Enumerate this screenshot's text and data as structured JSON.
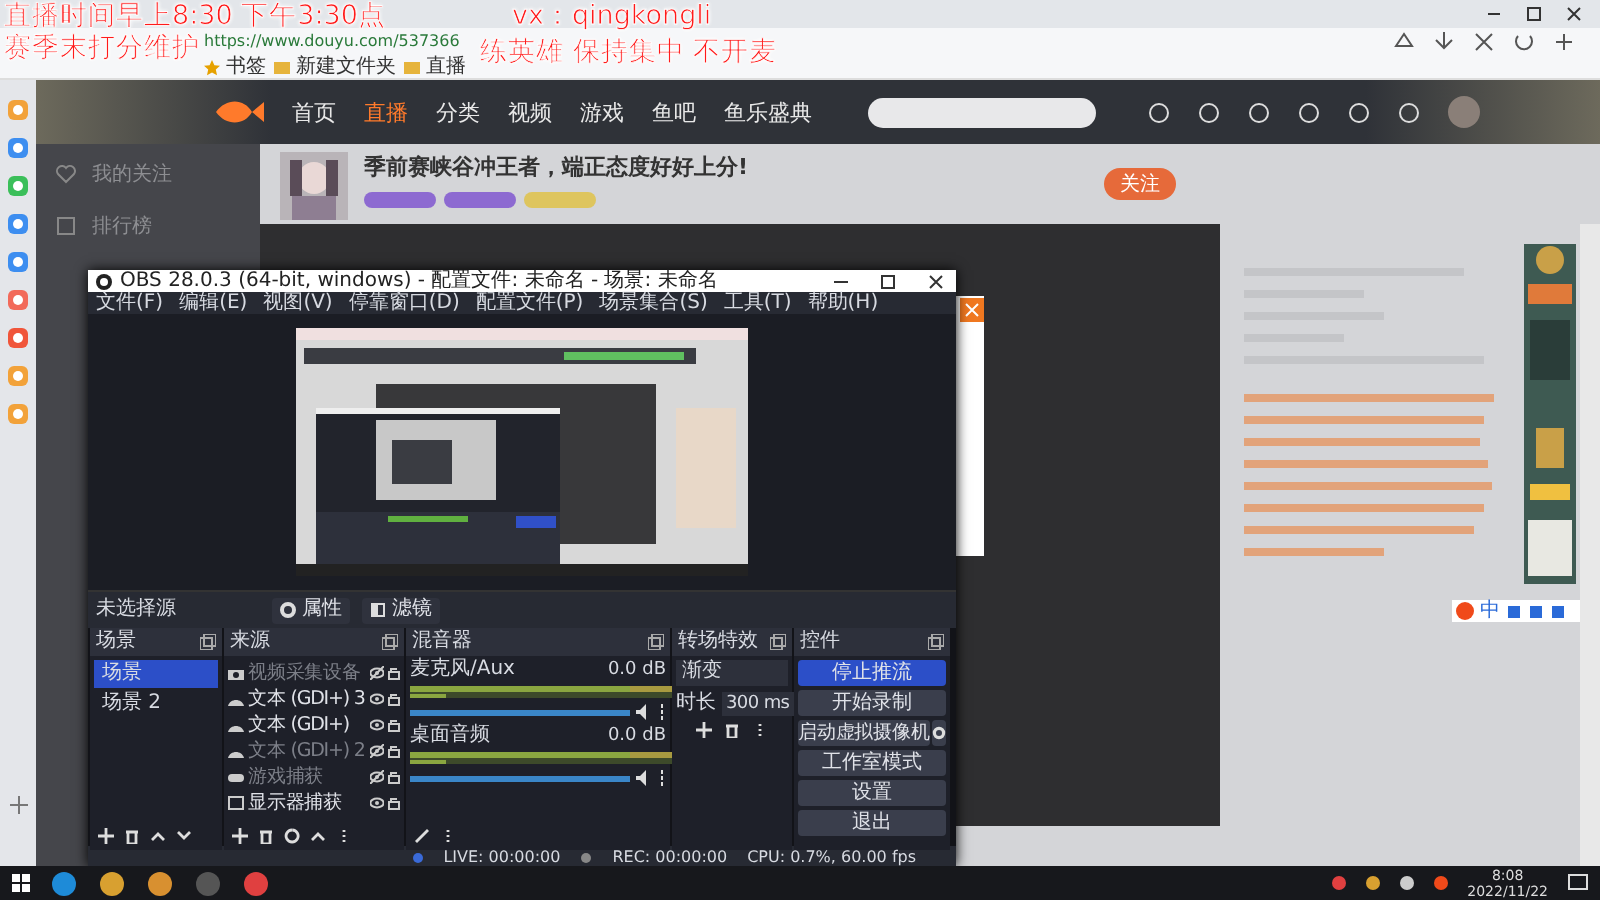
{
  "overlay": {
    "left_lines": [
      "直播时间早上8:30  下午3:30点",
      "赛季末打分维护"
    ],
    "right_lines": [
      "vx：qingkongli",
      "练英雄 保持集中 不开麦"
    ]
  },
  "browser": {
    "address": "https://www.douyu.com/537366",
    "bookmarks": [
      "书签",
      "新建文件夹",
      "直播"
    ],
    "nav": [
      {
        "label": "首页",
        "selected": false
      },
      {
        "label": "直播",
        "selected": true
      },
      {
        "label": "分类",
        "selected": false
      },
      {
        "label": "视频",
        "selected": false
      },
      {
        "label": "游戏",
        "selected": false
      },
      {
        "label": "鱼吧",
        "selected": false
      },
      {
        "label": "鱼乐盛典",
        "selected": false
      }
    ],
    "sidebar": [
      "我的关注",
      "排行榜"
    ],
    "room_title": "季前赛峡谷冲王者，端正态度好好上分!",
    "follow": "关注",
    "ime": "中"
  },
  "obs": {
    "title": "OBS 28.0.3 (64-bit, windows) - 配置文件: 未命名 - 场景: 未命名",
    "menu": [
      "文件(F)",
      "编辑(E)",
      "视图(V)",
      "停靠窗口(D)",
      "配置文件(P)",
      "场景集合(S)",
      "工具(T)",
      "帮助(H)"
    ],
    "no_source": "未选择源",
    "properties": "属性",
    "filters": "滤镜",
    "scenes": {
      "title": "场景",
      "items": [
        {
          "label": "场景",
          "selected": true
        },
        {
          "label": "场景 2",
          "selected": false
        }
      ]
    },
    "sources": {
      "title": "来源",
      "items": [
        {
          "label": "视频采集设备",
          "kind": "camera",
          "visible": false
        },
        {
          "label": "文本 (GDI+) 3",
          "kind": "text",
          "visible": true
        },
        {
          "label": "文本 (GDI+)",
          "kind": "text",
          "visible": true
        },
        {
          "label": "文本 (GDI+) 2",
          "kind": "text",
          "visible": false
        },
        {
          "label": "游戏捕获",
          "kind": "game",
          "visible": false
        },
        {
          "label": "显示器捕获",
          "kind": "monitor",
          "visible": true
        }
      ]
    },
    "mixer": {
      "title": "混音器",
      "channels": [
        {
          "name": "麦克风/Aux",
          "reading": "0.0 dB",
          "level": 1
        },
        {
          "name": "桌面音频",
          "reading": "0.0 dB",
          "level": 1
        }
      ]
    },
    "transitions": {
      "title": "转场特效",
      "value": "渐变",
      "duration_label": "时长",
      "duration": "300 ms"
    },
    "controls": {
      "title": "控件",
      "buttons": [
        {
          "label": "停止推流",
          "kind": "primary"
        },
        {
          "label": "开始录制",
          "kind": "plain"
        },
        {
          "label": "启动虚拟摄像机",
          "kind": "settings"
        },
        {
          "label": "工作室模式",
          "kind": "plain"
        },
        {
          "label": "设置",
          "kind": "plain"
        },
        {
          "label": "退出",
          "kind": "plain"
        }
      ]
    },
    "status": [
      "LIVE: 00:00:00",
      "REC: 00:00:00",
      "CPU: 0.7%, 60.00 fps"
    ]
  },
  "taskbar": {
    "time": "8:08",
    "date": "2022/11/22"
  }
}
